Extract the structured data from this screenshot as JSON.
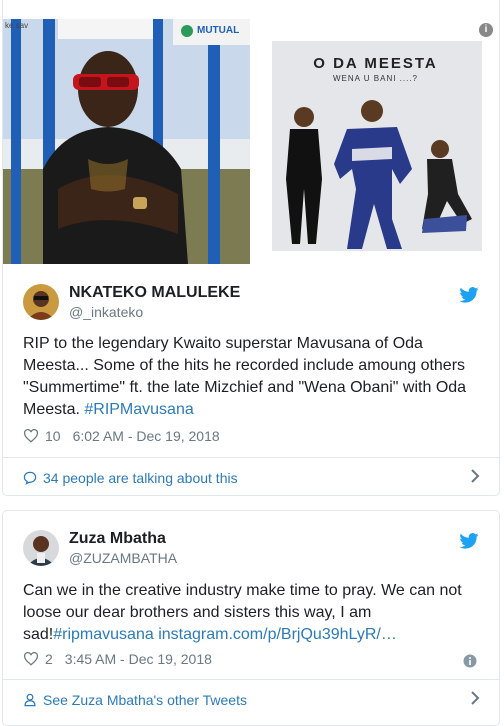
{
  "tweet1": {
    "media": {
      "album_title": "O DA MEESTA",
      "album_subtitle": "WENA U BANI ....?",
      "sign_text": "MUTUAL",
      "sign_text_left": "ke sav"
    },
    "author": {
      "display_name": "NKATEKO MALULEKE",
      "handle": "@_inkateko"
    },
    "text_plain": "RIP to the legendary Kwaito superstar Mavusana of Oda Meesta... Some of the hits he recorded include amoung others \"Summertime\" ft. the late Mizchief and \"Wena Obani\" with Oda Meesta. ",
    "hashtag": "#RIPMavusana",
    "likes": "10",
    "timestamp": "6:02 AM - Dec 19, 2018",
    "footer_label": "34 people are talking about this"
  },
  "tweet2": {
    "author": {
      "display_name": "Zuza Mbatha",
      "handle": "@ZUZAMBATHA"
    },
    "text_plain": "Can we in the creative industry make time to pray. We can not loose our dear brothers and sisters this way, I am sad!",
    "hashtag": "#ripmavusana",
    "link": "instagram.com/p/BrjQu39hLyR/…",
    "likes": "2",
    "timestamp": "3:45 AM - Dec 19, 2018",
    "footer_label": "See Zuza Mbatha's other Tweets"
  },
  "colors": {
    "link": "#2b7bb9",
    "meta": "#697882",
    "border": "#e1e8ed",
    "twitter_blue": "#1da1f2"
  },
  "icons": [
    "twitter-bird-icon",
    "heart-icon",
    "comment-bubble-icon",
    "person-icon",
    "chevron-right-icon",
    "info-icon"
  ]
}
